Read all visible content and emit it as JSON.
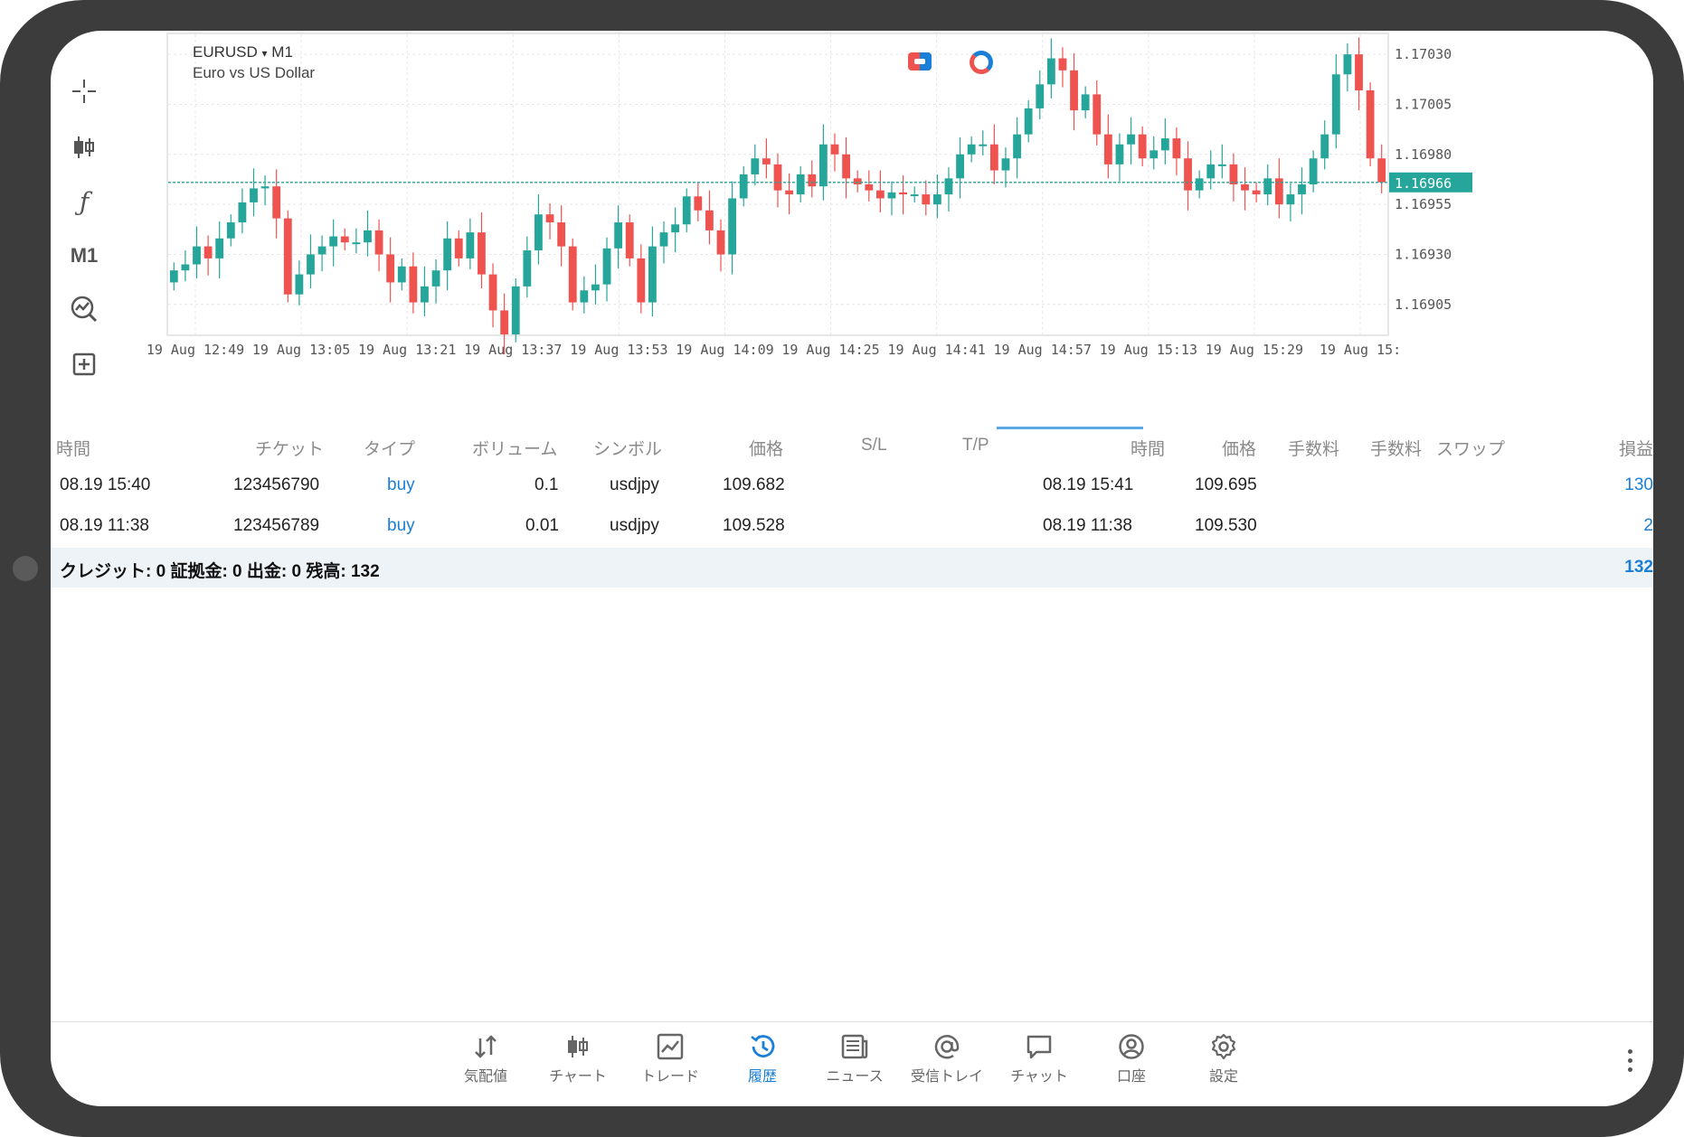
{
  "chart": {
    "symbol": "EURUSD",
    "timeframe": "M1",
    "description": "Euro vs US Dollar",
    "current_price": "1.16966",
    "price_ticks": [
      "1.17030",
      "1.17005",
      "1.16980",
      "1.16955",
      "1.16930",
      "1.16905"
    ],
    "time_ticks": [
      "19 Aug 12:49",
      "19 Aug 13:05",
      "19 Aug 13:21",
      "19 Aug 13:37",
      "19 Aug 13:53",
      "19 Aug 14:09",
      "19 Aug 14:25",
      "19 Aug 14:41",
      "19 Aug 14:57",
      "19 Aug 15:13",
      "19 Aug 15:29",
      "19 Aug 15:"
    ],
    "up_color": "#26a69a",
    "down_color": "#ef5350",
    "toolbar": {
      "timeframe_label": "M1"
    }
  },
  "chart_data": {
    "type": "candlestick",
    "series": [
      {
        "name": "EURUSD",
        "close": [
          1.16922,
          1.16925,
          1.16934,
          1.16928,
          1.16938,
          1.16946,
          1.16956,
          1.16963,
          1.16964,
          1.16948,
          1.1691,
          1.1692,
          1.1693,
          1.16934,
          1.16939,
          1.16936,
          1.16936,
          1.16942,
          1.1693,
          1.16916,
          1.16924,
          1.16906,
          1.16914,
          1.16922,
          1.16938,
          1.16928,
          1.16941,
          1.1692,
          1.16902,
          1.1689,
          1.16914,
          1.16932,
          1.1695,
          1.16946,
          1.16934,
          1.16906,
          1.16912,
          1.16915,
          1.16933,
          1.16946,
          1.16928,
          1.16906,
          1.16934,
          1.16941,
          1.16945,
          1.16959,
          1.16952,
          1.16942,
          1.1693,
          1.16958,
          1.1697,
          1.16978,
          1.16975,
          1.16962,
          1.1696,
          1.1697,
          1.16964,
          1.16985,
          1.1698,
          1.16968,
          1.16965,
          1.16962,
          1.16958,
          1.16961,
          1.1696,
          1.1696,
          1.16955,
          1.1696,
          1.16968,
          1.1698,
          1.16985,
          1.16985,
          1.16972,
          1.16978,
          1.1699,
          1.17003,
          1.17015,
          1.17028,
          1.17022,
          1.17002,
          1.1701,
          1.1699,
          1.16975,
          1.16985,
          1.1699,
          1.16978,
          1.16982,
          1.16988,
          1.16978,
          1.16962,
          1.16968,
          1.16975,
          1.16975,
          1.16965,
          1.16962,
          1.1696,
          1.16968,
          1.16955,
          1.1696,
          1.16965,
          1.16978,
          1.1699,
          1.1702,
          1.1703,
          1.17012,
          1.16978,
          1.16966
        ]
      }
    ],
    "xlabel": "",
    "ylabel": "",
    "ylim": [
      1.1689,
      1.1704
    ]
  },
  "history": {
    "columns": [
      "時間",
      "チケット",
      "タイプ",
      "ボリューム",
      "シンボル",
      "価格",
      "S/L",
      "T/P",
      "時間",
      "価格",
      "手数料",
      "手数料",
      "スワップ",
      "損益"
    ],
    "rows": [
      {
        "open_time": "08.19 15:40",
        "ticket": "123456790",
        "type": "buy",
        "volume": "0.1",
        "symbol": "usdjpy",
        "open_price": "109.682",
        "close_time": "08.19 15:41",
        "close_price": "109.695",
        "profit": "130"
      },
      {
        "open_time": "08.19 11:38",
        "ticket": "123456789",
        "type": "buy",
        "volume": "0.01",
        "symbol": "usdjpy",
        "open_price": "109.528",
        "close_time": "08.19 11:38",
        "close_price": "109.530",
        "profit": "2"
      }
    ],
    "summary_label": "クレジット: 0 証拠金: 0 出金: 0 残高: 132",
    "summary_total": "132"
  },
  "nav": {
    "items": [
      {
        "label": "気配値",
        "icon": "quotes-icon"
      },
      {
        "label": "チャート",
        "icon": "chart-icon"
      },
      {
        "label": "トレード",
        "icon": "trade-icon"
      },
      {
        "label": "履歴",
        "icon": "history-icon",
        "active": true
      },
      {
        "label": "ニュース",
        "icon": "news-icon"
      },
      {
        "label": "受信トレイ",
        "icon": "mail-icon"
      },
      {
        "label": "チャット",
        "icon": "chat-icon"
      },
      {
        "label": "口座",
        "icon": "account-icon"
      },
      {
        "label": "設定",
        "icon": "settings-icon"
      }
    ]
  }
}
